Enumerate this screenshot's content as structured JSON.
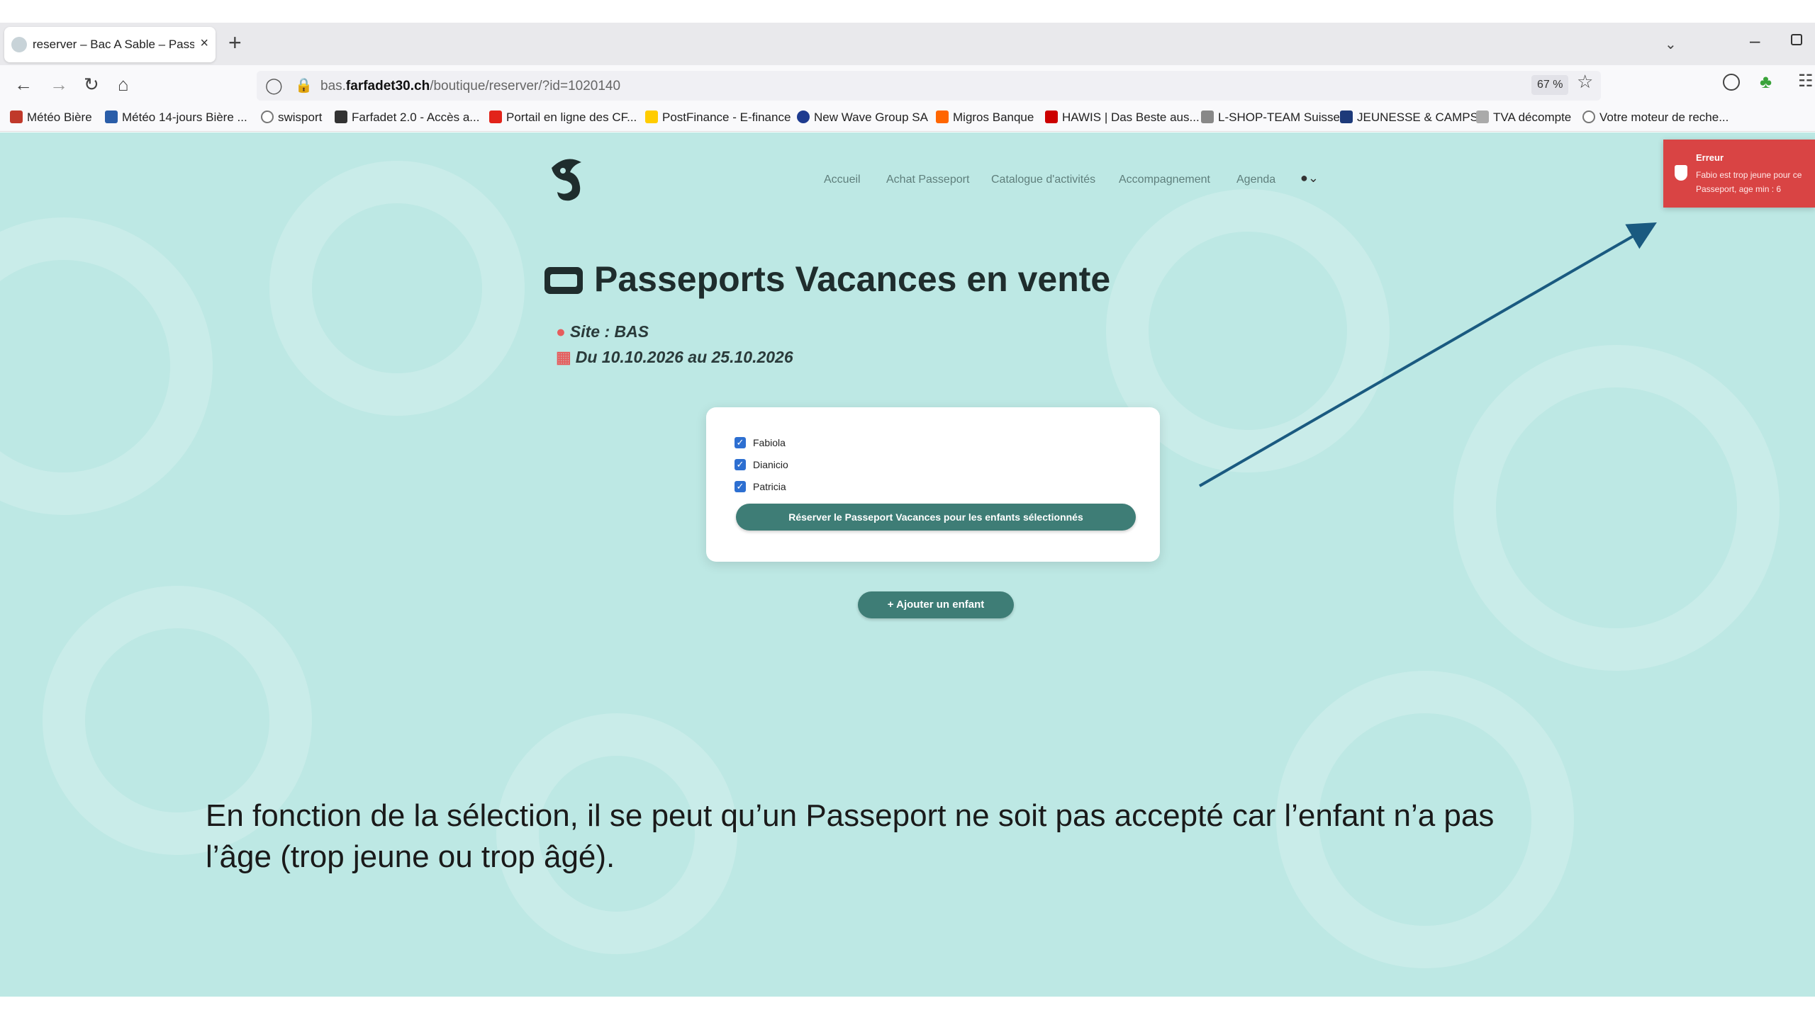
{
  "browser": {
    "tab_title": "reserver – Bac A Sable – Passep",
    "tab_close": "×",
    "new_tab": "+",
    "url_prefix": "bas.",
    "url_domain": "farfadet30.ch",
    "url_path": "/boutique/reserver/?id=1020140",
    "zoom": "67 %",
    "nav_icons": [
      "arrow-left",
      "arrow-right",
      "reload",
      "home"
    ],
    "bookmarks": [
      {
        "label": "Météo Bière",
        "icon_color": "#c0392b"
      },
      {
        "label": "Météo 14-jours Bière ...",
        "icon_color": "#2a5da8"
      },
      {
        "label": "swisport",
        "icon_color": "#777777"
      },
      {
        "label": "Farfadet 2.0 - Accès a...",
        "icon_color": "#333333"
      },
      {
        "label": "Portail en ligne des CF...",
        "icon_color": "#e2231a"
      },
      {
        "label": "PostFinance - E-finance",
        "icon_color": "#ffcc00"
      },
      {
        "label": "New Wave Group SA",
        "icon_color": "#1e3b8f"
      },
      {
        "label": "Migros Banque",
        "icon_color": "#ff6600"
      },
      {
        "label": "HAWIS | Das Beste aus...",
        "icon_color": "#cc0000"
      },
      {
        "label": "L-SHOP-TEAM Suisse",
        "icon_color": "#888888"
      },
      {
        "label": "JEUNESSE & CAMPS",
        "icon_color": "#1d3a7a"
      },
      {
        "label": "TVA décompte",
        "icon_color": "#aaaaaa"
      },
      {
        "label": "Votre moteur de reche...",
        "icon_color": "#777777"
      }
    ]
  },
  "site": {
    "menu": [
      "Accueil",
      "Achat Passeport",
      "Catalogue d'activités",
      "Accompagnement",
      "Agenda"
    ],
    "title": "Passeports Vacances en vente",
    "site_line": "Site : BAS",
    "date_line": "Du 10.10.2026 au 25.10.2026",
    "children": [
      {
        "name": "Fabiola",
        "checked": true
      },
      {
        "name": "Dianicio",
        "checked": true
      },
      {
        "name": "Patricia",
        "checked": true
      }
    ],
    "reserve_label": "Réserver le Passeport Vacances pour les enfants sélectionnés",
    "add_child_label": "+ Ajouter un enfant",
    "accent_color": "#3e7d76",
    "background_color": "#bde8e4"
  },
  "toast": {
    "title": "Erreur",
    "message": "Fabio est trop jeune pour ce Passeport, age min : 6",
    "color": "#d94444"
  },
  "annotation": {
    "line1": "En fonction de la sélection, il se peut qu’un Passeport ne soit pas accepté car l’enfant n’a pas",
    "line2": "l’âge (trop jeune ou trop âgé)."
  }
}
